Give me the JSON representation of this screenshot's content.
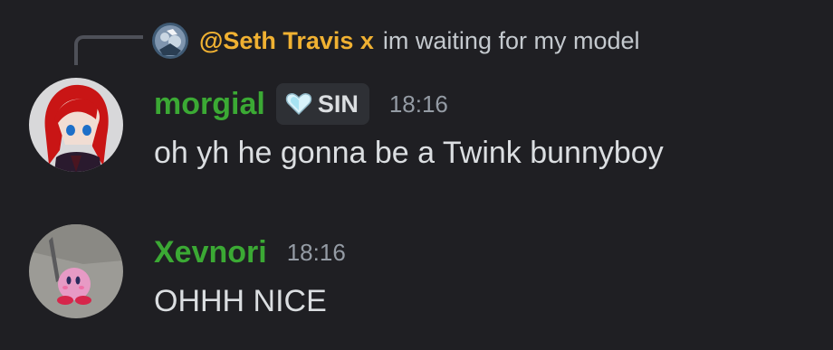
{
  "reply": {
    "author": "@Seth Travis x",
    "text": "im waiting for my model"
  },
  "messages": [
    {
      "username": "morgial",
      "tag": "SIN",
      "timestamp": "18:16",
      "text": "oh yh he gonna be a Twink bunnyboy"
    },
    {
      "username": "Xevnori",
      "timestamp": "18:16",
      "text": "OHHH NICE"
    }
  ],
  "colors": {
    "background": "#1f1f23",
    "reply_author": "#f0b132",
    "username": "#3ba934",
    "timestamp": "#949ba4",
    "message_text": "#dbdee1",
    "tag_background": "#2e3035"
  },
  "icons": {
    "tag": "heart-icon"
  }
}
